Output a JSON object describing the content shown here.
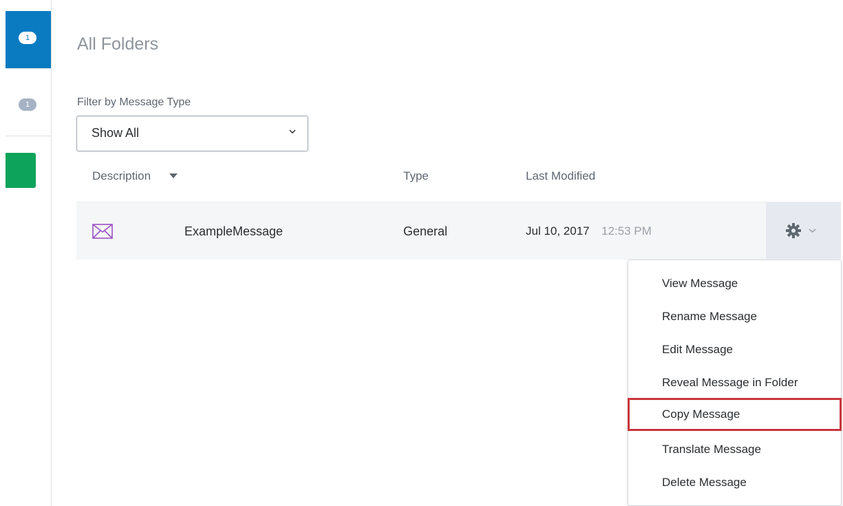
{
  "sidebar": {
    "badge_active": "1",
    "badge_secondary": "1",
    "colors": {
      "active": "#0a7bc1",
      "green": "#0da35a"
    }
  },
  "page": {
    "title": "All Folders"
  },
  "filter": {
    "label": "Filter by Message Type",
    "selected": "Show All"
  },
  "table": {
    "headers": {
      "description": "Description",
      "type": "Type",
      "last_modified": "Last Modified"
    },
    "rows": [
      {
        "icon": "envelope-icon",
        "name": "ExampleMessage",
        "type": "General",
        "date": "Jul 10, 2017",
        "time": "12:53 PM"
      }
    ]
  },
  "menu": {
    "items": [
      "View Message",
      "Rename Message",
      "Edit Message",
      "Reveal Message in Folder",
      "Copy Message",
      "Translate Message",
      "Delete Message"
    ],
    "highlighted_index": 4,
    "highlight_color": "#c9353b"
  }
}
